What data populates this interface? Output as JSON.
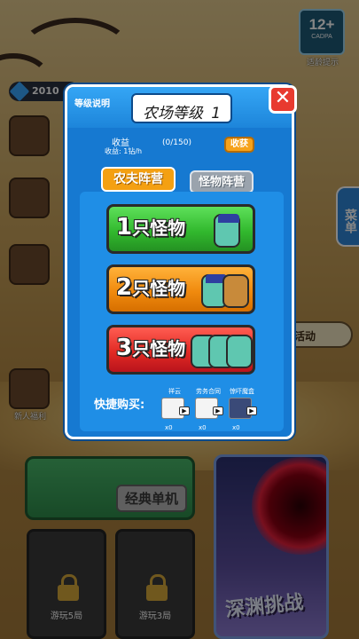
{
  "background": {
    "age_rating": "12+",
    "age_rating_sub": "CADPA",
    "age_tip": "适龄提示",
    "coins": "2010",
    "side_labels": [
      "新人福利"
    ],
    "menu_label": "菜单",
    "event_label": "活动",
    "classic_mode": "经典单机",
    "abyss_mode": "深渊挑战",
    "locked_cards": [
      "游玩5局",
      "游玩3局"
    ]
  },
  "dialog": {
    "help_label": "等级说明",
    "title": "农场等级",
    "level": "1",
    "close_glyph": "✕",
    "income_label": "收益",
    "income_rate": "收益: 1钻/h",
    "income_count": "(0/150)",
    "collect_label": "收获",
    "tabs": {
      "farmer": "农夫阵营",
      "monster": "怪物阵营"
    },
    "options": [
      {
        "count": "1",
        "label": "只怪物"
      },
      {
        "count": "2",
        "label": "只怪物"
      },
      {
        "count": "3",
        "label": "只怪物"
      }
    ],
    "quick_buy_label": "快捷购买:",
    "quick_items": [
      {
        "name": "祥云",
        "count": "x0"
      },
      {
        "name": "劳务合同",
        "count": "x0"
      },
      {
        "name": "惊吓魔盒",
        "count": "x0"
      }
    ]
  },
  "colors": {
    "dialog_blue": "#1679d1",
    "option_green": "#32b92e",
    "option_orange": "#f08a0e",
    "option_red": "#e22a24",
    "tab_active": "#f4a012",
    "close_red": "#e83a2f"
  }
}
